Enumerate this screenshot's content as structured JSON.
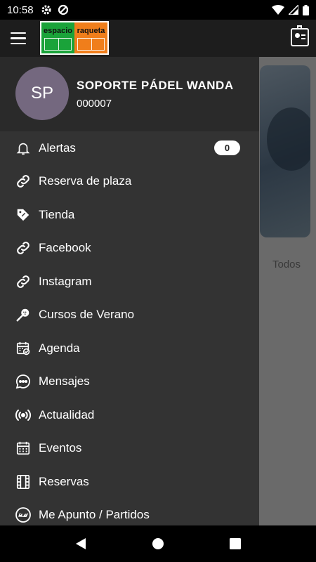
{
  "status_bar": {
    "time": "10:58"
  },
  "app_bar": {
    "logo_left": "espacio",
    "logo_right": "raqueta"
  },
  "background": {
    "filter_label": "Todos"
  },
  "drawer": {
    "user": {
      "initials": "SP",
      "name": "SOPORTE PÁDEL WANDA",
      "id": "000007"
    },
    "items": [
      {
        "label": "Alertas",
        "icon": "bell-icon",
        "badge": "0"
      },
      {
        "label": "Reserva de plaza",
        "icon": "link-icon"
      },
      {
        "label": "Tienda",
        "icon": "tag-icon"
      },
      {
        "label": "Facebook",
        "icon": "link-icon"
      },
      {
        "label": "Instagram",
        "icon": "link-icon"
      },
      {
        "label": "Cursos de Verano",
        "icon": "racket-icon"
      },
      {
        "label": "Agenda",
        "icon": "calendar-check-icon"
      },
      {
        "label": "Mensajes",
        "icon": "chat-icon"
      },
      {
        "label": "Actualidad",
        "icon": "broadcast-icon"
      },
      {
        "label": "Eventos",
        "icon": "calendar-grid-icon"
      },
      {
        "label": "Reservas",
        "icon": "film-icon"
      },
      {
        "label": "Me Apunto / Partidos",
        "icon": "play-icon"
      }
    ]
  },
  "colors": {
    "drawer_bg": "#333333",
    "header_bg": "#2a2a2a",
    "avatar_bg": "#74687f",
    "logo_green": "#1aa33a",
    "logo_orange": "#f07e1b"
  }
}
